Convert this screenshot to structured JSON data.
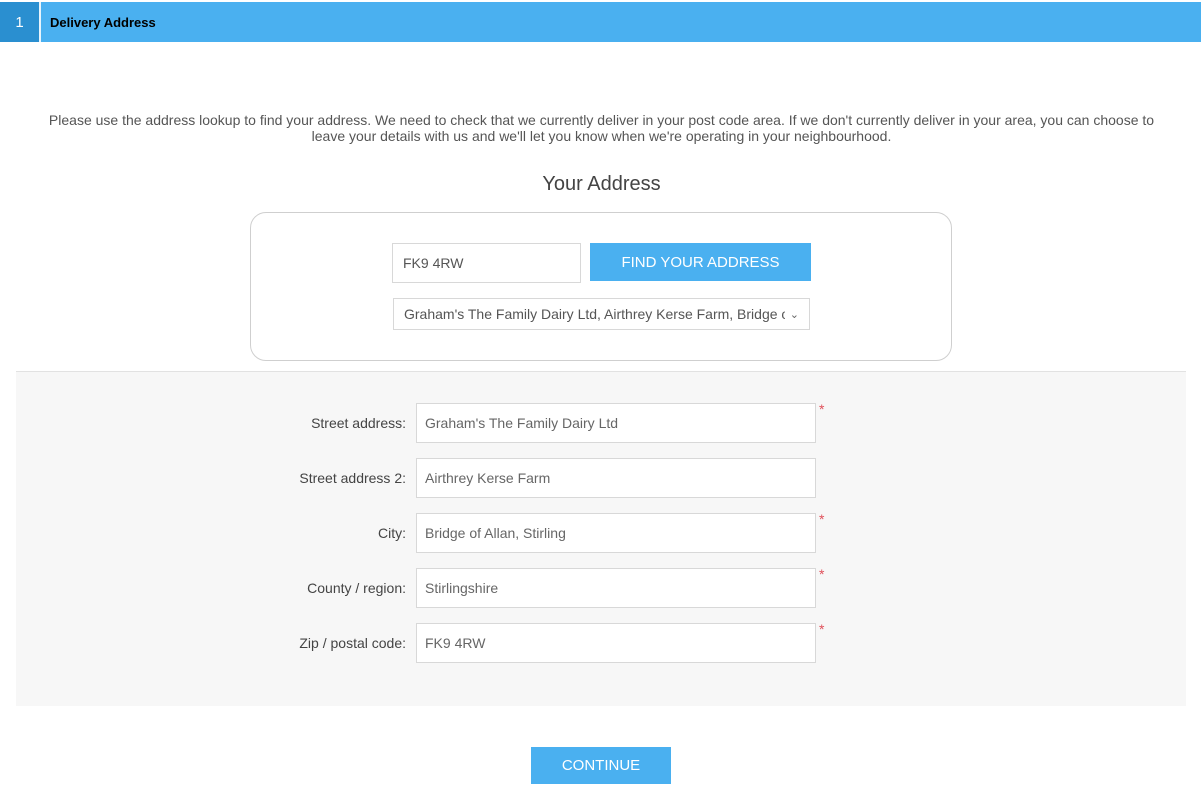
{
  "step": {
    "number": "1",
    "title": "Delivery Address"
  },
  "intro": "Please use the address lookup to find your address. We need to check that we currently deliver in your post code area. If we don't currently deliver in your area, you can choose to leave your details with us and we'll let you know when we're operating in your neighbourhood.",
  "section_title": "Your Address",
  "lookup": {
    "postcode_value": "FK9 4RW",
    "find_button_label": "FIND YOUR ADDRESS",
    "selected_address": "Graham's The Family Dairy Ltd, Airthrey Kerse Farm, Bridge of Allan, Stirling",
    "chevron_icon": "chevron-down-icon"
  },
  "form": {
    "fields": [
      {
        "label": "Street address:",
        "value": "Graham's The Family Dairy Ltd",
        "required": true
      },
      {
        "label": "Street address 2:",
        "value": "Airthrey Kerse Farm",
        "required": false
      },
      {
        "label": "City:",
        "value": "Bridge of Allan, Stirling",
        "required": true
      },
      {
        "label": "County / region:",
        "value": "Stirlingshire",
        "required": true
      },
      {
        "label": "Zip / postal code:",
        "value": "FK9 4RW",
        "required": true
      }
    ],
    "required_marker": "*"
  },
  "continue_label": "CONTINUE",
  "colors": {
    "accent": "#4ab0f0",
    "step_box": "#2a8fd0",
    "required": "#e0505a",
    "panel_bg": "#f7f7f7"
  }
}
